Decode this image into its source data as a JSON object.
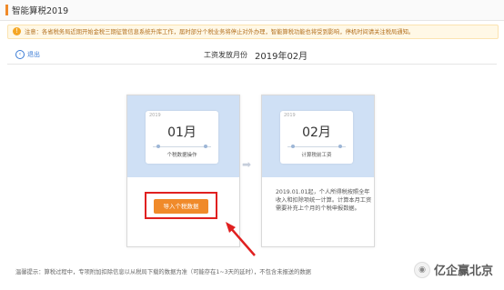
{
  "app": {
    "title": "智能算税2019"
  },
  "notice": {
    "text": "注意：各省税务局近期开始金税三期征管信息系统升库工作，届时部分个税业务将停止对外办理，智能算税功能也将受到影响，停机时间请关注税局通知。"
  },
  "nav": {
    "back_label": "退出"
  },
  "period": {
    "label": "工资发放月份",
    "value": "2019年02月"
  },
  "cards": [
    {
      "year": "2019",
      "month": "01月",
      "subtitle": "个税数据操作"
    },
    {
      "year": "2019",
      "month": "02月",
      "subtitle": "计算税前工资"
    }
  ],
  "import_button": {
    "label": "导入个税数据"
  },
  "card2_text": "2019.01.01起，个人所得税按照全年收入和扣除项统一计算。计算本月工资需要补充上个月的个税申报数据。",
  "tip": "温馨提示：算税过程中，专项附加扣除信息以从税局下载的数据为准（可能存在1~3天的延时），不包含未报送的数据",
  "watermark": {
    "text": "亿企赢北京"
  },
  "colors": {
    "accent": "#f08a2a",
    "highlight": "#e02020",
    "link": "#3a7bd5",
    "card_top": "#cfe0f5"
  }
}
